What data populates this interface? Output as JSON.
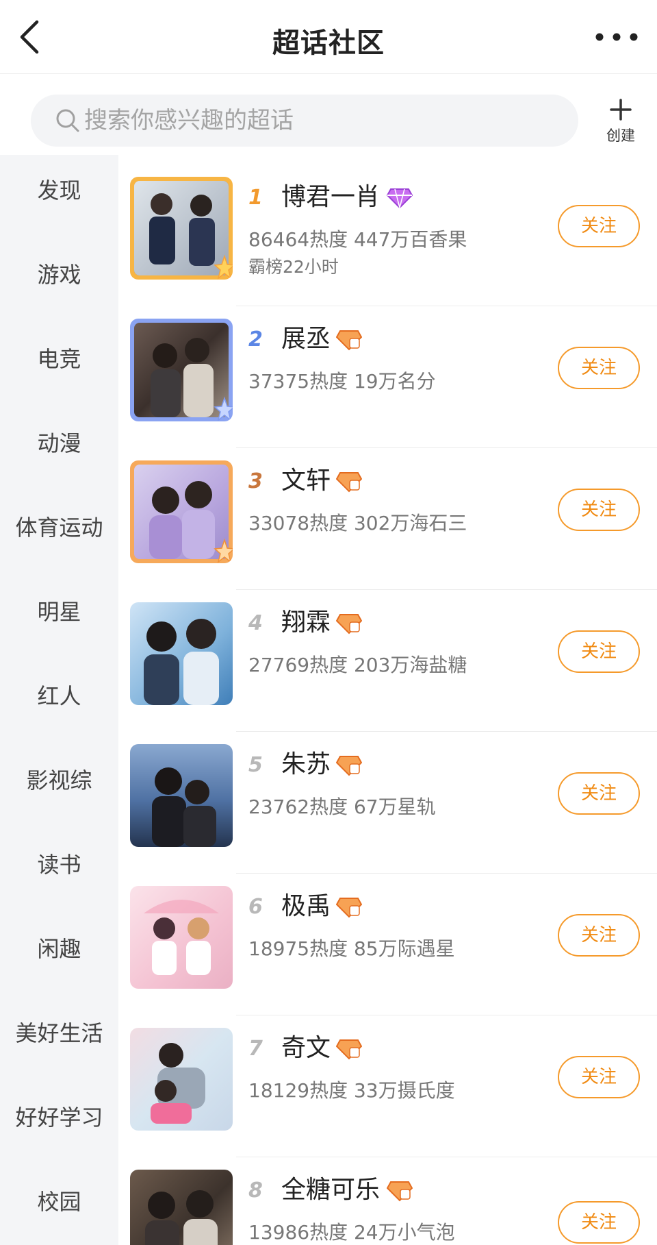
{
  "header": {
    "title": "超话社区",
    "back_icon": "chevron-left-icon",
    "more_icon": "more-dots-icon"
  },
  "search": {
    "placeholder": "搜索你感兴趣的超话",
    "icon": "search-icon"
  },
  "create": {
    "label": "创建",
    "icon": "plus-icon"
  },
  "sidebar": {
    "categories": [
      "发现",
      "游戏",
      "电竞",
      "动漫",
      "体育运动",
      "明星",
      "红人",
      "影视综",
      "读书",
      "闲趣",
      "美好生活",
      "好好学习",
      "校园"
    ]
  },
  "colors": {
    "accent": "#f59a2b",
    "sidebar_bg": "#f4f5f7",
    "rank1": "#f29a2e",
    "rank2": "#5b86e5",
    "rank3": "#c9773d"
  },
  "topics": [
    {
      "rank": "1",
      "name": "博君一肖",
      "stats": "86464热度 447万百香果",
      "sub": "霸榜22小时",
      "follow": "关注",
      "badge": "purple-diamond-badge-icon"
    },
    {
      "rank": "2",
      "name": "展丞",
      "stats": "37375热度 19万名分",
      "sub": "",
      "follow": "关注",
      "badge": "orange-level-badge-icon"
    },
    {
      "rank": "3",
      "name": "文轩",
      "stats": "33078热度 302万海石三",
      "sub": "",
      "follow": "关注",
      "badge": "orange-level-badge-icon"
    },
    {
      "rank": "4",
      "name": "翔霖",
      "stats": "27769热度 203万海盐糖",
      "sub": "",
      "follow": "关注",
      "badge": "orange-level-badge-icon"
    },
    {
      "rank": "5",
      "name": "朱苏",
      "stats": "23762热度 67万星轨",
      "sub": "",
      "follow": "关注",
      "badge": "orange-level-badge-icon"
    },
    {
      "rank": "6",
      "name": "极禹",
      "stats": "18975热度 85万际遇星",
      "sub": "",
      "follow": "关注",
      "badge": "orange-level-badge-icon"
    },
    {
      "rank": "7",
      "name": "奇文",
      "stats": "18129热度 33万摄氏度",
      "sub": "",
      "follow": "关注",
      "badge": "orange-level-badge-icon"
    },
    {
      "rank": "8",
      "name": "全糖可乐",
      "stats": "13986热度 24万小气泡",
      "sub": "",
      "follow": "关注",
      "badge": "orange-level-badge-icon"
    }
  ]
}
